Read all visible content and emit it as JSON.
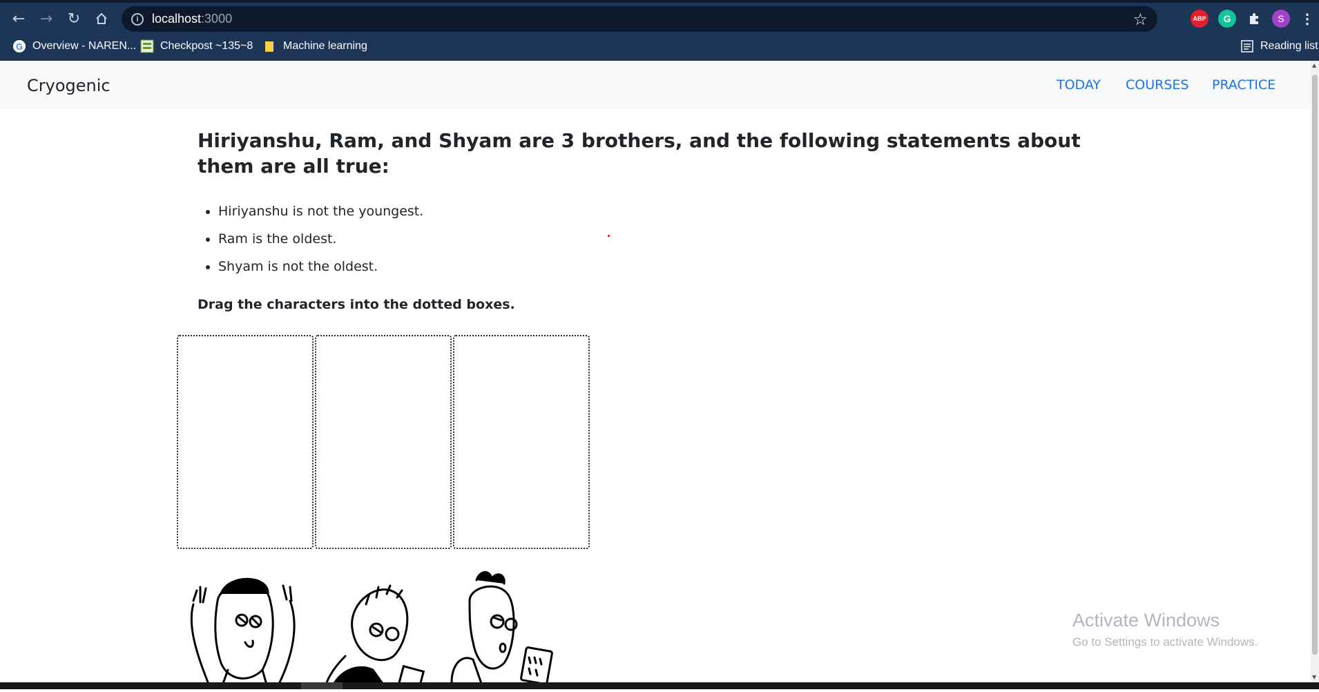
{
  "browser": {
    "url_host": "localhost",
    "url_port": ":3000",
    "extensions": [
      "ABP",
      "G"
    ],
    "profile_initial": "S",
    "bookmarks": [
      {
        "label": "Overview - NAREN...",
        "icon": "google-icon"
      },
      {
        "label": "Checkpost ~135~8",
        "icon": "site-favicon"
      },
      {
        "label": "Machine learning",
        "icon": "folder-icon"
      }
    ],
    "reading_list": "Reading list"
  },
  "navbar": {
    "brand": "Cryogenic",
    "links": [
      "TODAY",
      "COURSES",
      "PRACTICE"
    ],
    "link_color": "#1a73e8"
  },
  "puzzle": {
    "question": "Hiriyanshu, Ram, and Shyam are 3 brothers, and the following statements about them are all true:",
    "statements": [
      "Hiriyanshu is not the youngest.",
      "Ram is the oldest.",
      "Shyam is not the oldest."
    ],
    "instruction": "Drag the characters into the dotted boxes.",
    "drop_box_count": 3,
    "characters": [
      "character-1",
      "character-2",
      "character-3"
    ]
  },
  "watermark": {
    "line1": "Activate Windows",
    "line2": "Go to Settings to activate Windows."
  }
}
